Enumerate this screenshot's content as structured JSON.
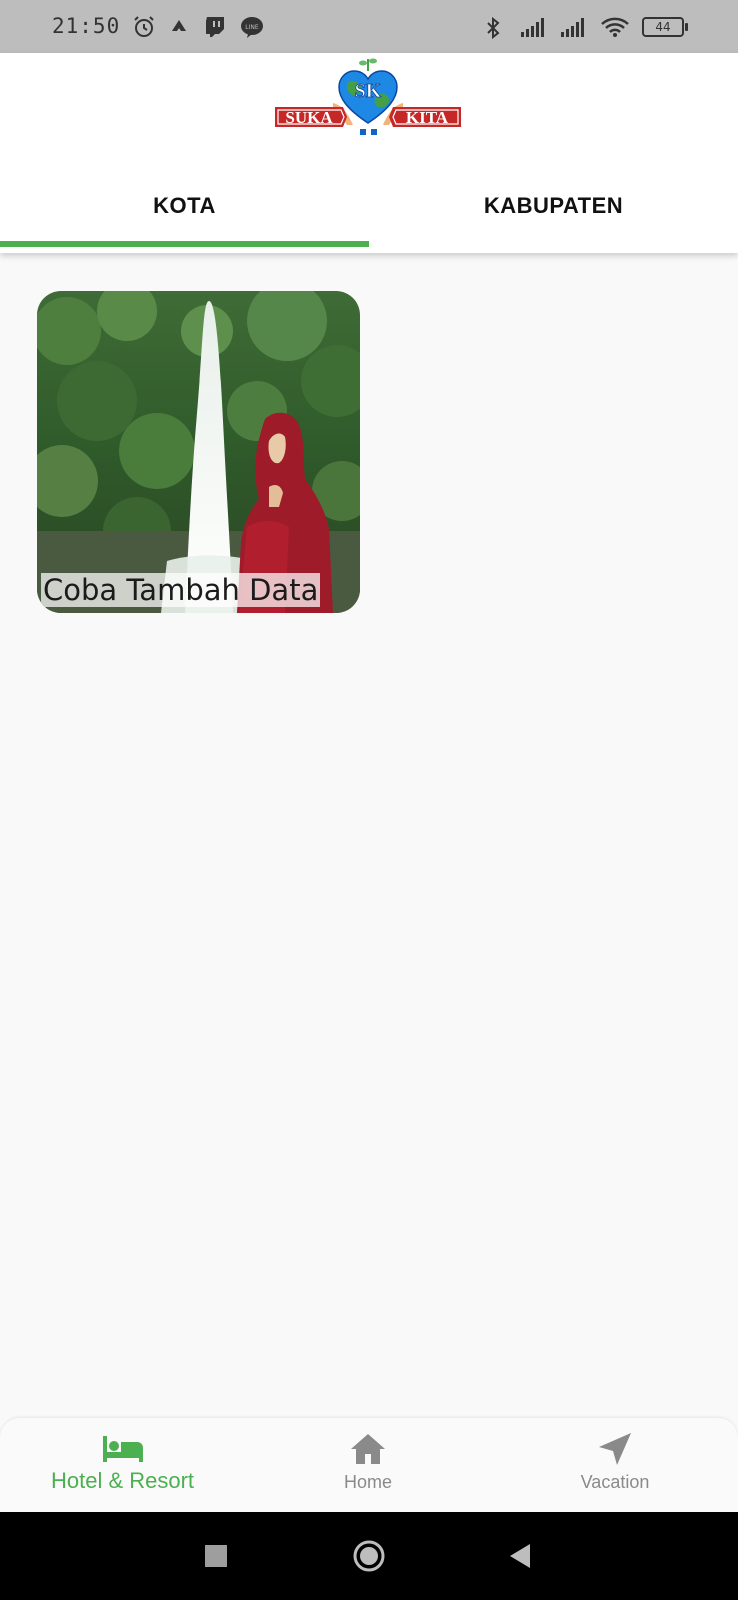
{
  "status_bar": {
    "time": "21:50",
    "battery": "44",
    "left_icons": [
      "alarm-icon",
      "arrival-icon",
      "twitch-icon",
      "line-icon"
    ],
    "right_icons": [
      "bluetooth-icon",
      "signal-icon",
      "signal-icon",
      "wifi-icon",
      "battery-icon"
    ]
  },
  "header": {
    "logo": {
      "left_text": "SUKA",
      "right_text": "KITA",
      "badge_text": "SK"
    },
    "tabs": [
      {
        "label": "KOTA",
        "active": true
      },
      {
        "label": "KABUPATEN",
        "active": false
      }
    ]
  },
  "main": {
    "cards": [
      {
        "label": "Coba Tambah Data",
        "image": "waterfall-photo"
      }
    ]
  },
  "bottom_nav": {
    "items": [
      {
        "label": "Hotel & Resort",
        "icon": "bed-icon",
        "active": true
      },
      {
        "label": "Home",
        "icon": "home-icon",
        "active": false
      },
      {
        "label": "Vacation",
        "icon": "navigation-arrow-icon",
        "active": false
      }
    ]
  },
  "system_nav": {
    "buttons": [
      "recents-icon",
      "home-circle-icon",
      "back-icon"
    ]
  },
  "colors": {
    "accent": "#4caf50",
    "status_bar": "#bdbdbd",
    "inactive": "#8a8a8a",
    "logo_red": "#c62828",
    "logo_blue": "#1e88e5"
  }
}
